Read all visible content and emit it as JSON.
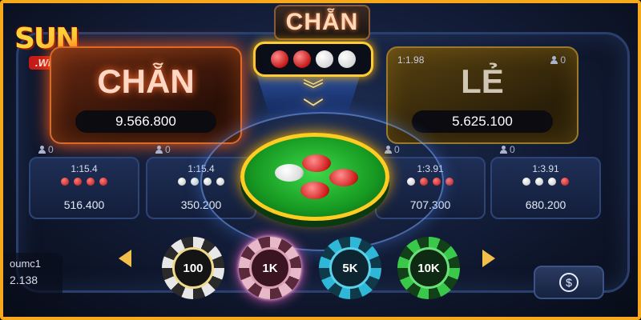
{
  "logo": {
    "brand": "SUN",
    "sub": ".Win"
  },
  "result": {
    "title": "CHẴN",
    "dice": [
      "red",
      "red",
      "white",
      "white"
    ]
  },
  "panels": {
    "chan": {
      "label": "CHẴN",
      "amount": "9.566.800"
    },
    "le": {
      "label": "LẺ",
      "amount": "5.625.100",
      "ratio": "1:1.98",
      "players": "0"
    }
  },
  "small_bets": [
    {
      "ratio": "1:15.4",
      "players": "0",
      "amount": "516.400",
      "dots": [
        "red",
        "red",
        "red",
        "red"
      ]
    },
    {
      "ratio": "1:15.4",
      "players": "0",
      "amount": "350.200",
      "dots": [
        "white",
        "white",
        "white",
        "white"
      ]
    },
    {
      "ratio": "1:3.91",
      "players": "0",
      "amount": "707.300",
      "dots": [
        "white",
        "red",
        "red",
        "red"
      ]
    },
    {
      "ratio": "1:3.91",
      "players": "0",
      "amount": "680.200",
      "dots": [
        "white",
        "white",
        "white",
        "red"
      ]
    }
  ],
  "plate": {
    "disks": [
      "white",
      "red",
      "red",
      "red"
    ]
  },
  "chips": [
    {
      "label": "100",
      "selected": false
    },
    {
      "label": "1K",
      "selected": true
    },
    {
      "label": "5K",
      "selected": false
    },
    {
      "label": "10K",
      "selected": false
    }
  ],
  "player": {
    "name": "oumc1",
    "balance": "2.138"
  },
  "icons": {
    "cash": "dollar-cycle-icon",
    "prev": "arrow-left-icon",
    "next": "arrow-right-icon"
  },
  "colors": {
    "accent": "#ffcc22",
    "frame": "#f7a81b",
    "red": "#c41818"
  }
}
